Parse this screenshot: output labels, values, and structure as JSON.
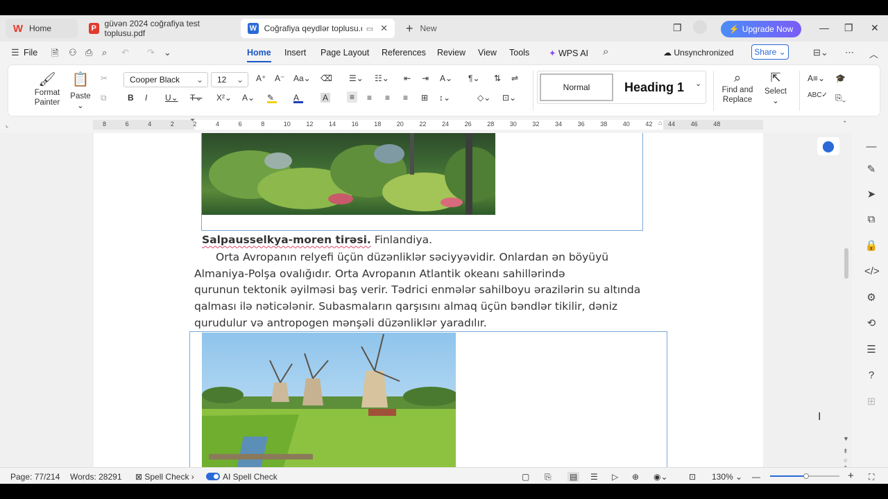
{
  "tabs": [
    {
      "label": "Home",
      "icon": "wps-logo-icon"
    },
    {
      "label": "güvən 2024 coğrafiya test toplusu.pdf",
      "icon": "pdf-icon"
    },
    {
      "label": "Coğrafiya qeydlər toplusu.doc",
      "icon": "word-doc-icon"
    }
  ],
  "new_tab_label": "New",
  "upgrade_label": "Upgrade Now",
  "menu": {
    "file_label": "File",
    "tabs": [
      "Home",
      "Insert",
      "Page Layout",
      "References",
      "Review",
      "View",
      "Tools"
    ],
    "active_tab": "Home",
    "wps_ai_label": "WPS AI",
    "sync_status": "Unsynchronized",
    "share_label": "Share"
  },
  "ribbon": {
    "format_painter": "Format Painter",
    "paste": "Paste",
    "font_name": "Cooper Black",
    "font_size": "12",
    "style_normal": "Normal",
    "style_heading": "Heading 1",
    "find_replace": "Find and Replace",
    "select": "Select",
    "colors": {
      "highlight": "#f5d10a",
      "font_color": "#1b3fb5"
    }
  },
  "ruler_ticks": [
    "8",
    "6",
    "4",
    "2",
    "2",
    "4",
    "6",
    "8",
    "10",
    "12",
    "14",
    "16",
    "18",
    "20",
    "22",
    "24",
    "26",
    "28",
    "30",
    "32",
    "34",
    "36",
    "38",
    "40",
    "42",
    "44",
    "46",
    "48"
  ],
  "document": {
    "caption_bold": "Salpausselkya-moren tirəsi.",
    "caption_rest": " Finlandiya.",
    "paragraph_lines": [
      "Orta Avropanın relyefi üçün düzənliklər səciyyəvidir. Onlardan ən böyüyü",
      "Almaniya-Polşa ovalığıdır. Orta Avropanın Atlantik okeanı sahillərində",
      "qurunun tektonik əyilməsi baş verir. Tədrici enmələr sahilboyu ərazilərin su altında",
      "qalması ilə nəticələnir. Subasmaların qarşısını almaq üçün bəndlər tikilir, dəniz",
      "qurudulur və antropogen mənşəli düzənliklər yaradılır."
    ]
  },
  "status": {
    "page": "Page: 77/214",
    "words": "Words: 28291",
    "spell_check": "Spell Check",
    "ai_spell_check": "AI Spell Check",
    "zoom": "130%"
  }
}
